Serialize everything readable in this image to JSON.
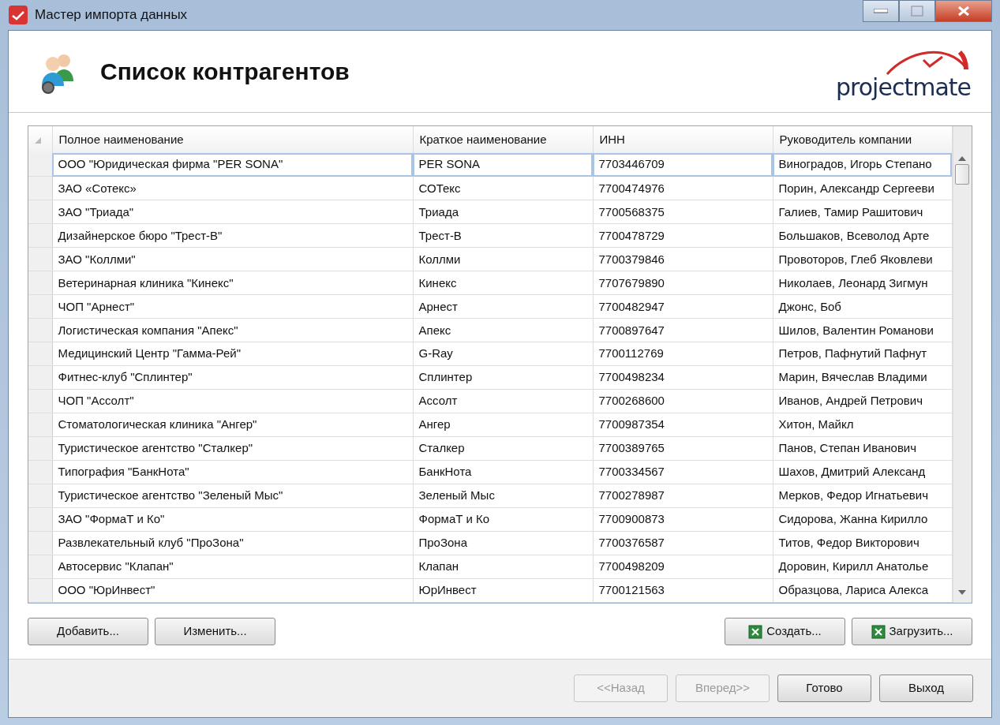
{
  "window": {
    "title": "Мастер импорта данных"
  },
  "header": {
    "title": "Список контрагентов",
    "logo_text": "projectmate"
  },
  "table": {
    "columns": [
      "Полное наименование",
      "Краткое наименование",
      "ИНН",
      "Руководитель компании"
    ],
    "rows": [
      {
        "cells": [
          "ООО \"Юридическая фирма \"PER SONA\"",
          "PER SONA",
          "7703446709",
          "Виноградов, Игорь Степано"
        ],
        "selected": true
      },
      {
        "cells": [
          "ЗАО «Сотекс»",
          "СОТекс",
          "7700474976",
          "Порин, Александр Сергееви"
        ],
        "selected": false
      },
      {
        "cells": [
          "ЗАО \"Триада\"",
          "Триада",
          "7700568375",
          "Галиев, Тамир Рашитович"
        ],
        "selected": false
      },
      {
        "cells": [
          "Дизайнерское бюро \"Трест-В\"",
          "Трест-В",
          "7700478729",
          "Большаков, Всеволод Арте"
        ],
        "selected": false
      },
      {
        "cells": [
          "ЗАО \"Коллми\"",
          "Коллми",
          "7700379846",
          "Провоторов, Глеб Яковлеви"
        ],
        "selected": false
      },
      {
        "cells": [
          "Ветеринарная клиника \"Кинекс\"",
          "Кинекс",
          "7707679890",
          "Николаев, Леонард Зигмун"
        ],
        "selected": false
      },
      {
        "cells": [
          "ЧОП \"Арнест\"",
          "Арнест",
          "7700482947",
          "Джонс, Боб"
        ],
        "selected": false
      },
      {
        "cells": [
          "Логистическая компания \"Апекс\"",
          "Апекс",
          "7700897647",
          "Шилов, Валентин Романови"
        ],
        "selected": false
      },
      {
        "cells": [
          "Медицинский Центр \"Гамма-Рей\"",
          "G-Ray",
          "7700112769",
          "Петров, Пафнутий Пафнут"
        ],
        "selected": false
      },
      {
        "cells": [
          "Фитнес-клуб \"Сплинтер\"",
          "Сплинтер",
          "7700498234",
          "Марин, Вячеслав Владими"
        ],
        "selected": false
      },
      {
        "cells": [
          "ЧОП \"Ассолт\"",
          "Ассолт",
          "7700268600",
          "Иванов, Андрей Петрович"
        ],
        "selected": false
      },
      {
        "cells": [
          "Стоматологическая клиника \"Ангер\"",
          "Ангер",
          "7700987354",
          "Хитон, Майкл"
        ],
        "selected": false
      },
      {
        "cells": [
          "Туристическое агентство \"Сталкер\"",
          "Сталкер",
          "7700389765",
          "Панов, Степан Иванович"
        ],
        "selected": false
      },
      {
        "cells": [
          "Типография \"БанкНота\"",
          "БанкНота",
          "7700334567",
          "Шахов, Дмитрий Александ"
        ],
        "selected": false
      },
      {
        "cells": [
          "Туристическое агентство \"Зеленый Мыс\"",
          "Зеленый Мыс",
          "7700278987",
          "Мерков, Федор Игнатьевич"
        ],
        "selected": false
      },
      {
        "cells": [
          "ЗАО \"ФормаТ и Ко\"",
          "ФормаТ и Ко",
          "7700900873",
          "Сидорова, Жанна Кирилло"
        ],
        "selected": false
      },
      {
        "cells": [
          "Развлекательный клуб \"ПроЗона\"",
          "ПроЗона",
          "7700376587",
          "Титов, Федор Викторович"
        ],
        "selected": false
      },
      {
        "cells": [
          "Автосервис \"Клапан\"",
          "Клапан",
          "7700498209",
          "Доровин, Кирилл Анатолье"
        ],
        "selected": false
      },
      {
        "cells": [
          "ООО \"ЮрИнвест\"",
          "ЮрИнвест",
          "7700121563",
          "Образцова, Лариса Алекса"
        ],
        "selected": false
      }
    ]
  },
  "actions_left": [
    {
      "label": "Добавить..."
    },
    {
      "label": "Изменить..."
    }
  ],
  "actions_right": [
    {
      "label": "Создать...",
      "kind": "excel"
    },
    {
      "label": "Загрузить...",
      "kind": "excel"
    }
  ],
  "nav_buttons": [
    {
      "label": "<<Назад",
      "disabled": true
    },
    {
      "label": "Вперед>>",
      "disabled": true
    },
    {
      "label": "Готово",
      "disabled": false
    },
    {
      "label": "Выход",
      "disabled": false
    }
  ]
}
